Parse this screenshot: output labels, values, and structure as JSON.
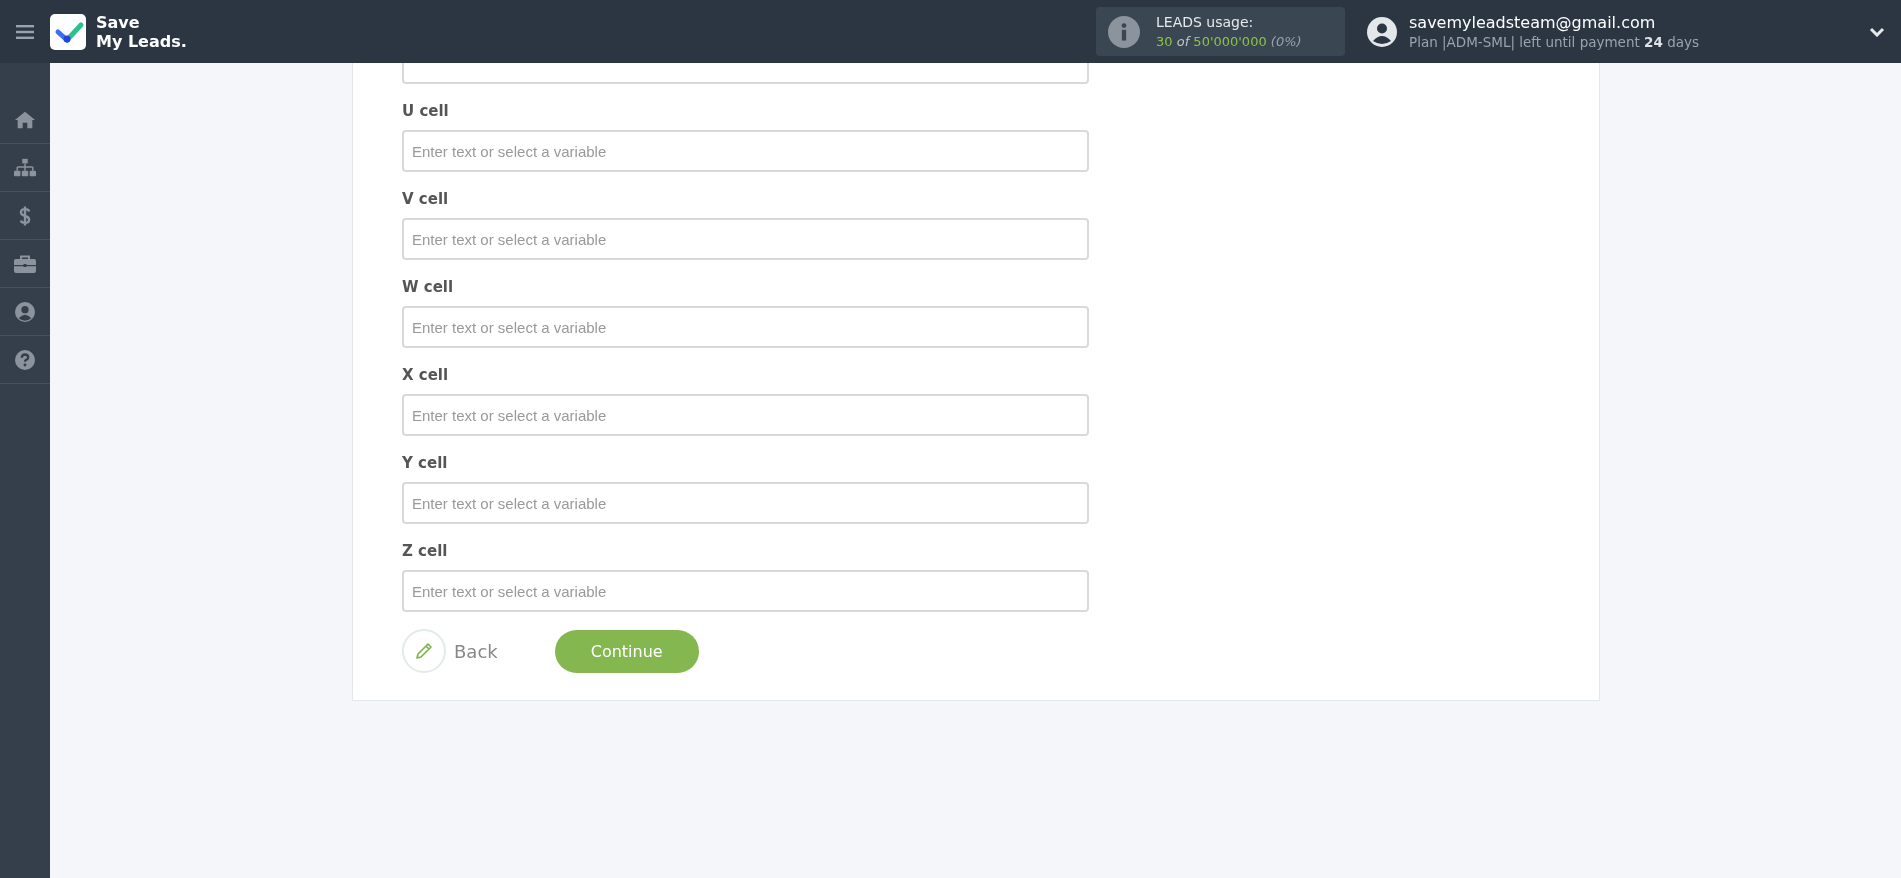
{
  "header": {
    "logo_lines": [
      "Save",
      "My Leads."
    ],
    "usage": {
      "label": "LEADS usage:",
      "used": "30",
      "of": "of",
      "limit": "50'000'000",
      "percent": "(0%)"
    },
    "account": {
      "email": "savemyleadsteam@gmail.com",
      "plan": "Plan |ADM-SML| left until payment **24** days"
    }
  },
  "sidebar": {
    "items": [
      {
        "kind": "home"
      },
      {
        "kind": "sitemap"
      },
      {
        "kind": "dollar"
      },
      {
        "kind": "briefcase"
      },
      {
        "kind": "user"
      },
      {
        "kind": "help"
      }
    ]
  },
  "form": {
    "fields": [
      {
        "kind": "cut-off"
      },
      {
        "label": "U cell",
        "placeholder": "Enter text or select a variable"
      },
      {
        "label": "V cell",
        "placeholder": "Enter text or select a variable"
      },
      {
        "label": "W cell",
        "placeholder": "Enter text or select a variable"
      },
      {
        "label": "X cell",
        "placeholder": "Enter text or select a variable"
      },
      {
        "label": "Y cell",
        "placeholder": "Enter text or select a variable"
      },
      {
        "label": "Z cell",
        "placeholder": "Enter text or select a variable"
      }
    ],
    "back": "Back",
    "continue": "Continue"
  }
}
